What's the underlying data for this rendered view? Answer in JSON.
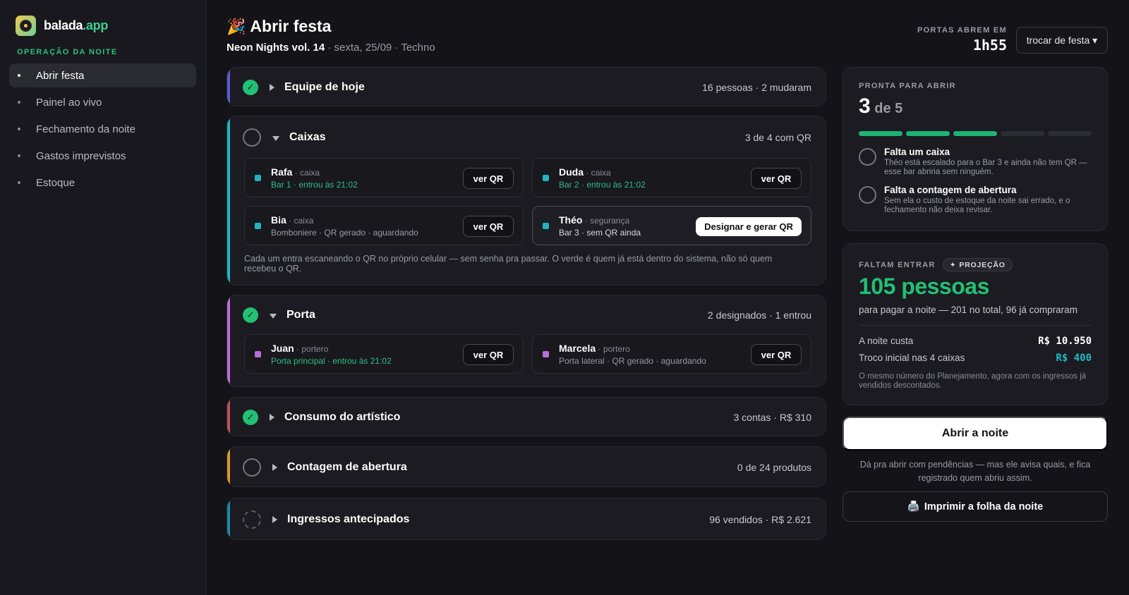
{
  "brand": {
    "name": "balada",
    "suffix": ".app"
  },
  "sidebar": {
    "section_label": "OPERAÇÃO DA NOITE",
    "items": [
      {
        "label": "Abrir festa",
        "active": true
      },
      {
        "label": "Painel ao vivo"
      },
      {
        "label": "Fechamento da noite"
      },
      {
        "label": "Gastos imprevistos"
      },
      {
        "label": "Estoque"
      }
    ]
  },
  "header": {
    "icon": "party-popper-icon",
    "title": "Abrir festa",
    "event_name": "Neon Nights vol. 14",
    "event_meta": " · sexta, 25/09 · Techno",
    "doors_label": "PORTAS ABREM EM",
    "doors_time": "1h55",
    "switch_button": "trocar de festa ▾"
  },
  "sections": {
    "equipe": {
      "title": "Equipe de hoje",
      "meta": "16 pessoas · 2 mudaram",
      "status": "done",
      "accent": "#5b5bd6"
    },
    "caixas": {
      "title": "Caixas",
      "meta": "3 de 4 com QR",
      "status": "pending",
      "accent": "#1fb5c0",
      "cards": [
        {
          "name": "Rafa",
          "role": " · caixa",
          "detail": "Bar 1 · entrou às 21:02",
          "action": "ver QR"
        },
        {
          "name": "Duda",
          "role": " · caixa",
          "detail": "Bar 2 · entrou às 21:02",
          "action": "ver QR"
        },
        {
          "name": "Bia",
          "role": " · caixa",
          "detail": "Bomboniere · QR gerado · aguardando",
          "action": "ver QR"
        },
        {
          "name": "Théo",
          "role": " · segurança",
          "detail": "Bar 3 · sem QR ainda",
          "action": "Designar e gerar QR"
        }
      ],
      "note": "Cada um entra escaneando o QR no próprio celular — sem senha pra passar. O verde é quem já está dentro do sistema, não só quem recebeu o QR."
    },
    "porta": {
      "title": "Porta",
      "meta": "2 designados · 1 entrou",
      "status": "done",
      "accent": "#b86fd6",
      "cards": [
        {
          "name": "Juan",
          "role": " · portero",
          "detail": "Porta principal · entrou às 21:02",
          "action": "ver QR"
        },
        {
          "name": "Marcela",
          "role": " · portero",
          "detail": "Porta lateral · QR gerado · aguardando",
          "action": "ver QR"
        }
      ]
    },
    "consumo": {
      "title": "Consumo do artístico",
      "meta": "3 contas · R$ 310",
      "status": "done",
      "accent": "#c0505a"
    },
    "contagem": {
      "title": "Contagem de abertura",
      "meta": "0 de 24 produtos",
      "status": "pending",
      "accent": "#d69a2a"
    },
    "ingressos": {
      "title": "Ingressos antecipados",
      "meta": "96 vendidos · R$ 2.621",
      "status": "loading",
      "accent": "#1a8aa0"
    }
  },
  "ready_panel": {
    "label": "PRONTA PARA ABRIR",
    "count": "3",
    "of_text": " de 5",
    "done": 3,
    "total": 5,
    "pendencies": [
      {
        "title": "Falta um caixa",
        "desc": "Théo está escalado para o Bar 3 e ainda não tem QR — esse bar abriria sem ninguém."
      },
      {
        "title": "Falta a contagem de abertura",
        "desc": "Sem ela o custo de estoque da noite sai errado, e o fechamento não deixa revisar."
      }
    ]
  },
  "projection_panel": {
    "label": "FALTAM ENTRAR",
    "badge": "PROJEÇÃO",
    "badge_icon": "sparkle-icon",
    "big_value": "105 pessoas",
    "subline": "para pagar a noite — 201 no total, 96 já compraram",
    "rows": [
      {
        "label": "A noite custa",
        "value": "R$ 10.950"
      },
      {
        "label": "Troco inicial nas 4 caixas",
        "value": "R$ 400"
      }
    ],
    "note": "O mesmo número do Planejamento, agora com os ingressos já vendidos descontados."
  },
  "actions": {
    "open_button": "Abrir a noite",
    "open_note": "Dá pra abrir com pendências — mas ele avisa quais, e fica registrado quem abriu assim.",
    "print_icon": "printer-icon",
    "print_button": "Imprimir a folha da noite"
  }
}
